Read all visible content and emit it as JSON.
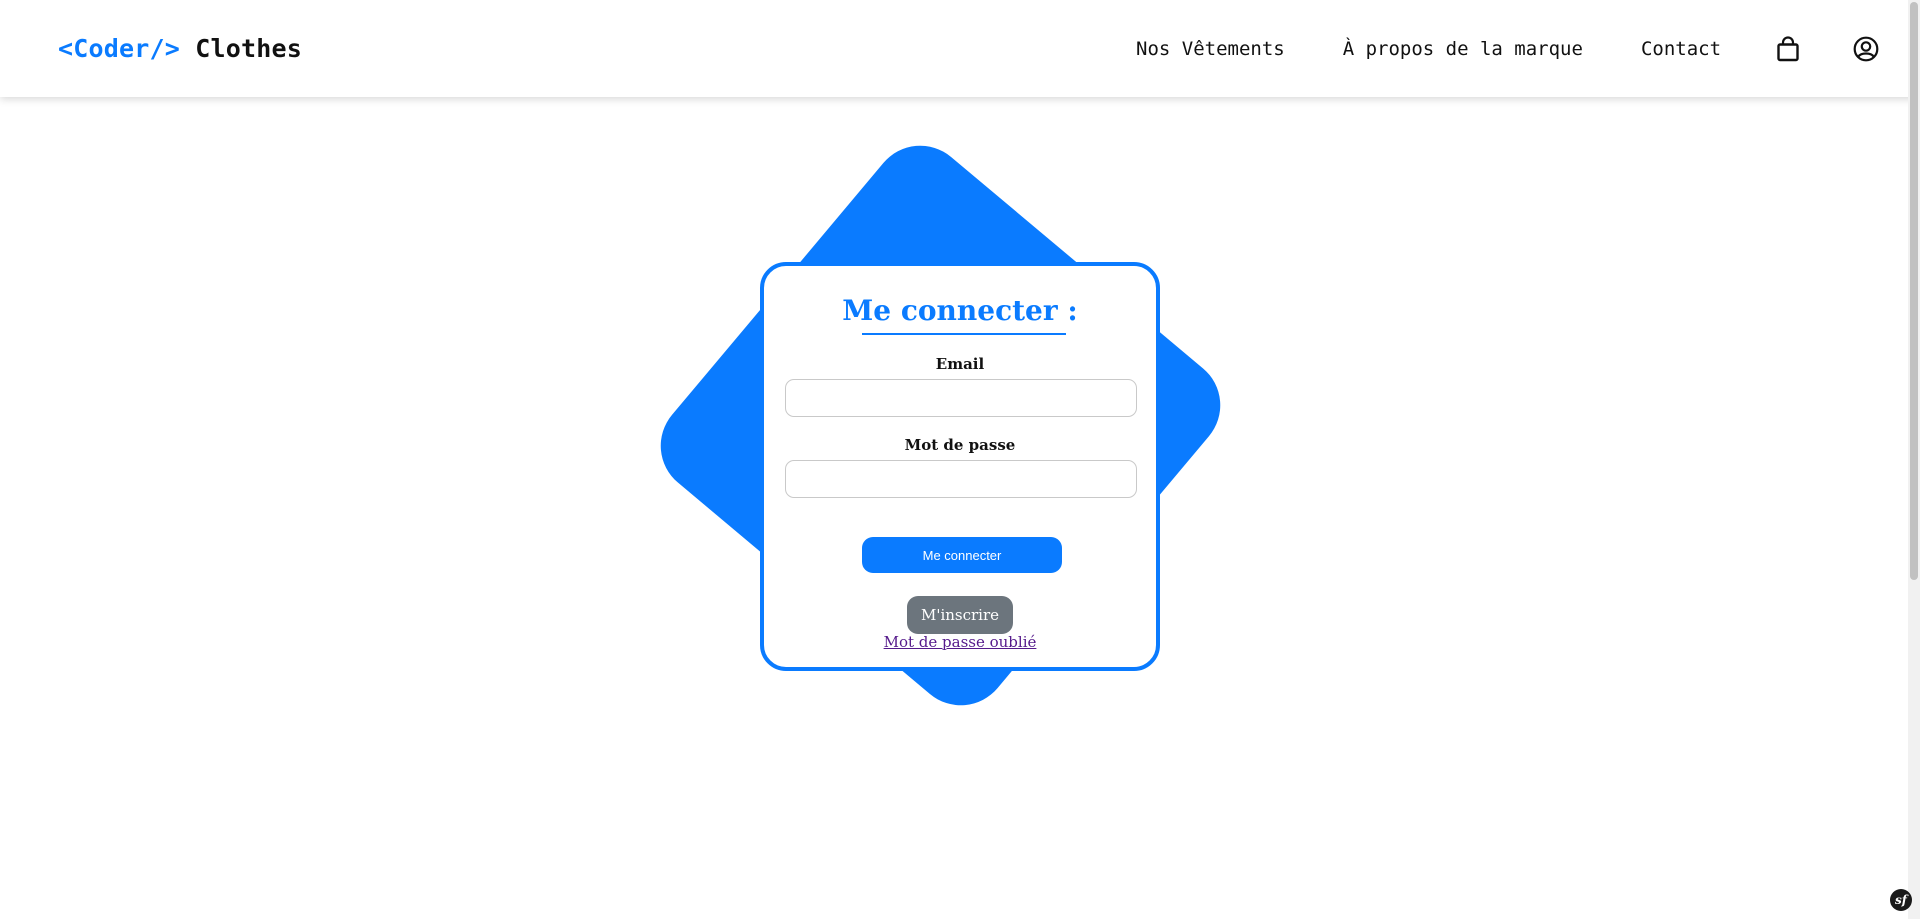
{
  "header": {
    "brand_code": "<Coder/>",
    "brand_name": "Clothes",
    "nav": [
      {
        "label": "Nos Vêtements"
      },
      {
        "label": "À propos de la marque"
      },
      {
        "label": "Contact"
      }
    ],
    "icons": [
      "shopping-bag-icon",
      "user-circle-icon"
    ]
  },
  "login": {
    "title": "Me connecter :",
    "email_label": "Email",
    "email_value": "",
    "password_label": "Mot de passe",
    "password_value": "",
    "submit_label": "Me connecter",
    "register_label": "M'inscrire",
    "forgot_label": "Mot de passe oublié"
  },
  "debug": {
    "badge_text": "sf"
  },
  "colors": {
    "accent": "#0a7bff",
    "secondary_button": "#6c757d",
    "visited_link": "#551a8b"
  }
}
